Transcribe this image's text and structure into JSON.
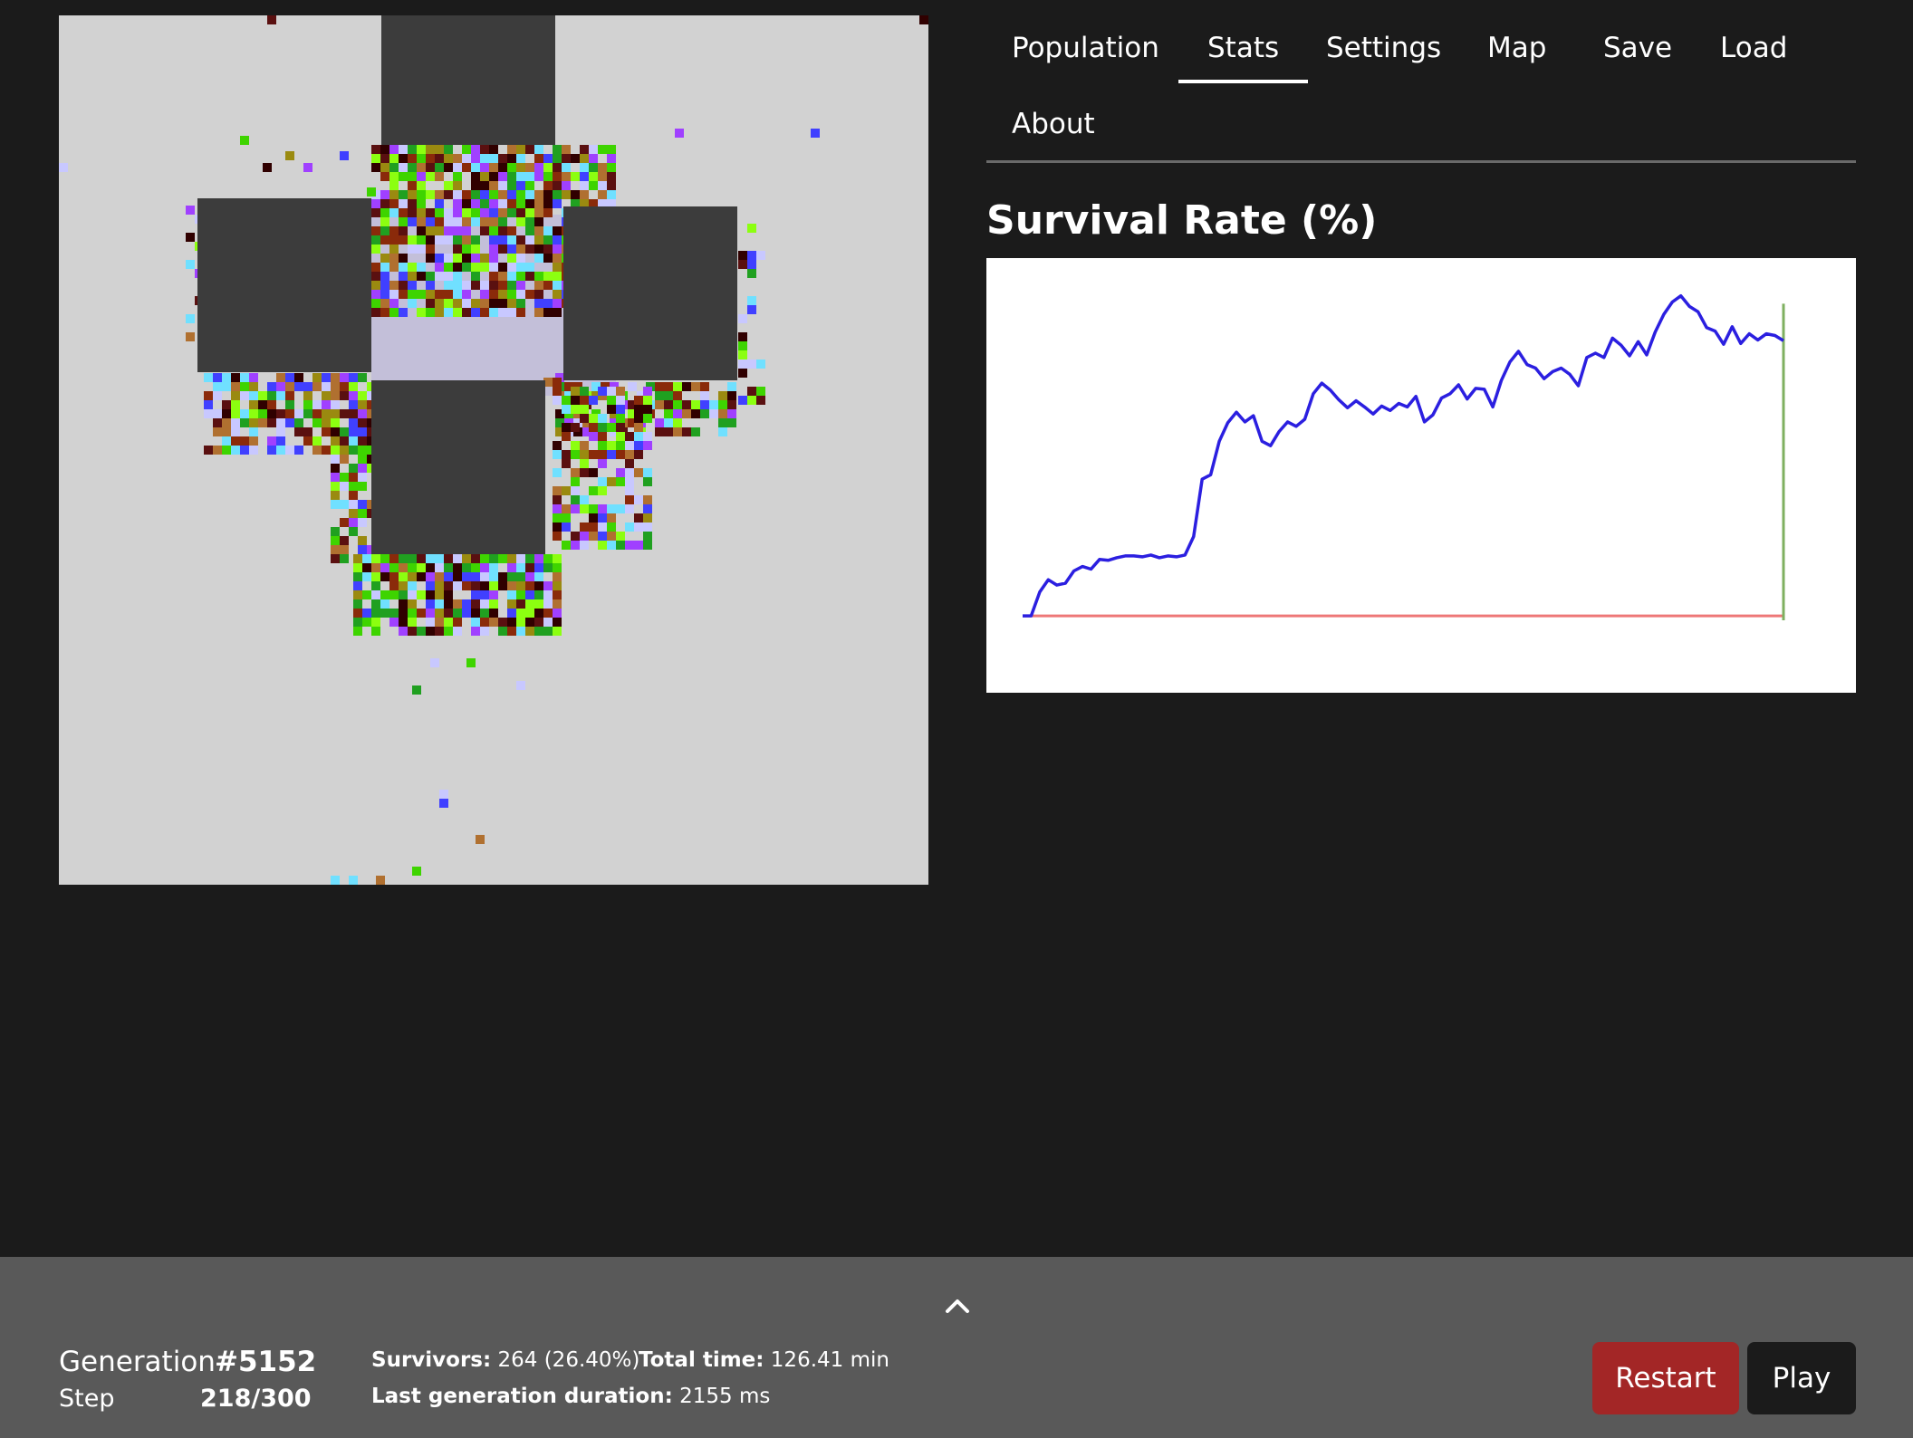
{
  "nav": {
    "tabs": [
      {
        "label": "Population"
      },
      {
        "label": "Stats"
      },
      {
        "label": "Settings"
      },
      {
        "label": "Map"
      },
      {
        "label": "Save"
      },
      {
        "label": "Load"
      },
      {
        "label": "About"
      }
    ],
    "active_tab": "Stats"
  },
  "colors": {
    "world_background": "#d2d2d2",
    "obstacle": "#3c3c3c",
    "safe_zone": "#c3bfd9",
    "survival_line": "#2b1fe0",
    "baseline": "#ee7777",
    "marker": "#7fb060",
    "restart_button": "#a32626",
    "play_button": "#1b1b1b",
    "footer_background": "#595959",
    "creature_palette": [
      "#8a2a0a",
      "#3ed400",
      "#9a8a10",
      "#5a1010",
      "#8cff10",
      "#b07030",
      "#70e0ff",
      "#4040ff",
      "#a040ff",
      "#20a020",
      "#c8c8ff",
      "#300000"
    ]
  },
  "stats": {
    "chart_data": {
      "type": "line",
      "title": "Survival Rate (%)",
      "xlabel": "",
      "ylabel": "",
      "grid": false,
      "legend": "none",
      "series": [
        {
          "values": [
            0.5,
            0.5,
            3.2,
            4.6,
            4.0,
            4.2,
            5.6,
            6.1,
            5.8,
            6.9,
            6.8,
            7.1,
            7.3,
            7.3,
            7.2,
            7.4,
            7.1,
            7.3,
            7.2,
            7.4,
            9.5,
            16.0,
            16.5,
            20.3,
            22.4,
            23.6,
            22.5,
            23.2,
            20.3,
            19.8,
            21.4,
            22.5,
            22.0,
            22.8,
            25.7,
            26.9,
            26.1,
            25.0,
            24.1,
            24.9,
            24.2,
            23.4,
            24.3,
            23.8,
            24.6,
            24.2,
            25.4,
            22.5,
            23.3,
            25.2,
            25.7,
            26.7,
            25.1,
            26.3,
            26.2,
            24.2,
            27.2,
            29.3,
            30.5,
            29.0,
            28.6,
            27.4,
            28.2,
            28.6,
            27.9,
            26.6,
            29.8,
            30.3,
            29.8,
            32.0,
            31.2,
            30.0,
            31.6,
            30.1,
            32.7,
            34.7,
            36.1,
            36.8,
            35.6,
            35.0,
            33.2,
            32.8,
            31.3,
            33.3,
            31.4,
            32.5,
            31.8,
            32.5,
            32.3,
            31.7
          ]
        },
        {
          "values": [
            0.5,
            0.5
          ]
        }
      ],
      "x_range": [
        0,
        89
      ],
      "marker_at_index": 89,
      "ylim": [
        0,
        38
      ]
    }
  },
  "footer": {
    "generation_label": "Generation",
    "generation_value": "#5152",
    "step_label": "Step",
    "step_value": "218/300",
    "survivors_label": "Survivors:",
    "survivors_value": "264 (26.40%)",
    "total_time_label": "Total time:",
    "total_time_value": "126.41 min",
    "last_gen_label": "Last generation duration:",
    "last_gen_value": "2155 ms",
    "toggle_icon": "chevron-up-icon",
    "restart_label": "Restart",
    "play_label": "Play"
  }
}
